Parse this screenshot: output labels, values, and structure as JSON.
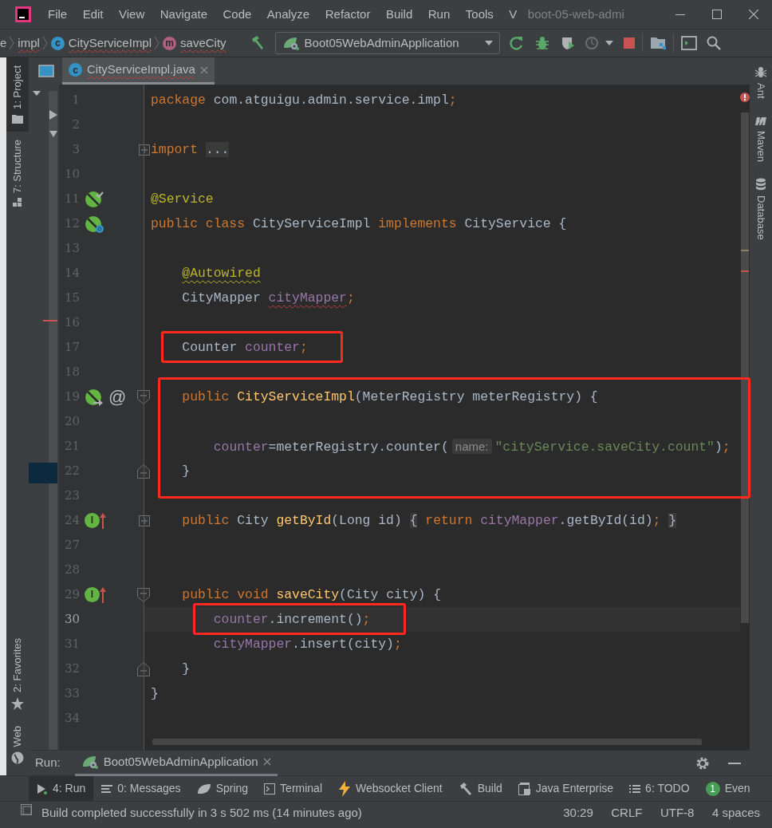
{
  "title_bar": {
    "menu": [
      "File",
      "Edit",
      "View",
      "Navigate",
      "Code",
      "Analyze",
      "Refactor",
      "Build",
      "Run",
      "Tools",
      "V"
    ],
    "title": "boot-05-web-admi"
  },
  "nav_bar": {
    "breadcrumbs": [
      {
        "text": "e",
        "kind": "plain",
        "error": false
      },
      {
        "text": "impl",
        "kind": "plain",
        "error": true
      },
      {
        "text": "CityServiceImpl",
        "kind": "class",
        "icon_letter": "c",
        "error": true
      },
      {
        "text": "saveCity",
        "kind": "method",
        "icon_letter": "m",
        "error": true
      }
    ],
    "run_config": "Boot05WebAdminApplication"
  },
  "editor_tabs": [
    {
      "label": "CityServiceImpl.java",
      "icon_letter": "c",
      "selected": true,
      "error": true
    }
  ],
  "left_tool_windows": [
    {
      "label": "1: Project",
      "kind": "project",
      "selected": true
    },
    {
      "label": "7: Structure",
      "kind": "structure",
      "selected": false
    }
  ],
  "left_bottom_tool_windows": [
    {
      "label": "2: Favorites",
      "kind": "favorites",
      "selected": false
    },
    {
      "label": "Web",
      "kind": "web",
      "selected": false
    }
  ],
  "right_tool_windows": [
    {
      "label": "Ant",
      "kind": "ant"
    },
    {
      "label": "Maven",
      "kind": "maven"
    },
    {
      "label": "Database",
      "kind": "database"
    }
  ],
  "code": {
    "sections": [
      {
        "highlighted": false,
        "lines": [
          {
            "number": "1",
            "current": false,
            "tokens": [
              {
                "kind": "kw",
                "t": "package"
              },
              {
                "kind": "plain",
                "t": " com.atguigu.admin.service.impl"
              },
              {
                "kind": "kw",
                "t": ";"
              }
            ]
          },
          {
            "number": "2",
            "current": false
          },
          {
            "number": "3",
            "current": false,
            "fold": {
              "kind": "plus"
            },
            "tokens": [
              {
                "kind": "kw",
                "t": "import"
              },
              {
                "kind": "folded",
                "t": " ..."
              }
            ]
          },
          {
            "number": "10",
            "current": false
          },
          {
            "number": "11",
            "current": false,
            "gutter": [
              {
                "kind": "bean-check"
              }
            ],
            "tokens": [
              {
                "kind": "ann",
                "t": "@Service"
              }
            ]
          },
          {
            "number": "12",
            "current": false,
            "gutter": [
              {
                "kind": "bean-class"
              }
            ],
            "tokens": [
              {
                "kind": "kw",
                "t": "public class "
              },
              {
                "kind": "plain",
                "t": "CityServiceImpl "
              },
              {
                "kind": "kw",
                "t": "implements "
              },
              {
                "kind": "plain",
                "t": "CityService {"
              }
            ]
          },
          {
            "number": "13",
            "current": false
          },
          {
            "number": "14",
            "current": false,
            "tokens": [
              {
                "kind": "ann",
                "t": "    @Autowired",
                "squiggle": {
                  "kind": "warning"
                }
              }
            ]
          },
          {
            "number": "15",
            "current": false,
            "tokens": [
              {
                "kind": "plain",
                "t": "    CityMapper "
              },
              {
                "kind": "field",
                "t": "cityMapper",
                "squiggle": {
                  "kind": "error"
                }
              },
              {
                "kind": "kw",
                "t": ";"
              }
            ]
          },
          {
            "number": "16",
            "current": false
          }
        ]
      },
      {
        "highlighted": true,
        "lines": [
          {
            "number": "17",
            "current": false,
            "tokens": [
              {
                "kind": "plain",
                "t": "    Counter "
              },
              {
                "kind": "field",
                "t": "counter"
              },
              {
                "kind": "kw",
                "t": ";"
              }
            ]
          }
        ]
      },
      {
        "highlighted": false,
        "lines": [
          {
            "number": "18",
            "current": false
          }
        ]
      },
      {
        "highlighted": true,
        "lines": [
          {
            "number": "19",
            "current": false,
            "fold": {
              "kind": "start"
            },
            "gutter": [
              {
                "kind": "bean-arrow"
              },
              {
                "kind": "text",
                "text": "@"
              }
            ],
            "tokens": [
              {
                "kind": "kw",
                "t": "    public "
              },
              {
                "kind": "method",
                "t": "CityServiceImpl"
              },
              {
                "kind": "plain",
                "t": "(MeterRegistry meterRegistry) {"
              }
            ]
          },
          {
            "number": "20",
            "current": false
          },
          {
            "number": "21",
            "current": false,
            "tokens": [
              {
                "kind": "field",
                "t": "        counter"
              },
              {
                "kind": "plain",
                "t": "=meterRegistry.counter("
              },
              {
                "kind": "hint",
                "t": "name:"
              },
              {
                "kind": "str",
                "t": "″cityService.saveCity.count″"
              },
              {
                "kind": "plain",
                "t": ")"
              },
              {
                "kind": "kw",
                "t": ";"
              }
            ]
          },
          {
            "number": "22",
            "current": false,
            "fold": {
              "kind": "end"
            },
            "tokens": [
              {
                "kind": "plain",
                "t": "    }"
              }
            ]
          }
        ]
      },
      {
        "highlighted": false,
        "lines": [
          {
            "number": "23",
            "current": false
          },
          {
            "number": "24",
            "current": false,
            "fold": {
              "kind": "plus"
            },
            "gutter": [
              {
                "kind": "implemented",
                "letter": "I"
              }
            ],
            "tokens": [
              {
                "kind": "kw",
                "t": "    public "
              },
              {
                "kind": "plain",
                "t": "City "
              },
              {
                "kind": "method",
                "t": "getById"
              },
              {
                "kind": "plain",
                "t": "(Long id) "
              },
              {
                "kind": "folded",
                "t": "{"
              },
              {
                "kind": "kw",
                "t": " return "
              },
              {
                "kind": "field",
                "t": "cityMapper"
              },
              {
                "kind": "plain",
                "t": ".getById(id)"
              },
              {
                "kind": "kw",
                "t": ";"
              },
              {
                "kind": "folded",
                "t": " }"
              }
            ]
          },
          {
            "number": "27",
            "current": false
          },
          {
            "number": "28",
            "current": false
          },
          {
            "number": "29",
            "current": false,
            "fold": {
              "kind": "start"
            },
            "gutter": [
              {
                "kind": "implemented",
                "letter": "I"
              }
            ],
            "tokens": [
              {
                "kind": "kw",
                "t": "    public void "
              },
              {
                "kind": "method",
                "t": "saveCity"
              },
              {
                "kind": "plain",
                "t": "(City city) {"
              }
            ]
          }
        ]
      },
      {
        "highlighted": true,
        "lines": [
          {
            "number": "30",
            "current": true,
            "tokens": [
              {
                "kind": "field",
                "t": "        counter"
              },
              {
                "kind": "plain",
                "t": ".increment()"
              },
              {
                "kind": "kw",
                "t": ";"
              }
            ]
          }
        ]
      },
      {
        "highlighted": false,
        "lines": [
          {
            "number": "31",
            "current": false,
            "tokens": [
              {
                "kind": "field",
                "t": "        cityMapper"
              },
              {
                "kind": "plain",
                "t": ".insert(city)"
              },
              {
                "kind": "kw",
                "t": ";"
              }
            ]
          },
          {
            "number": "32",
            "current": false,
            "fold": {
              "kind": "end"
            },
            "tokens": [
              {
                "kind": "plain",
                "t": "    }"
              }
            ]
          },
          {
            "number": "33",
            "current": false,
            "tokens": [
              {
                "kind": "plain",
                "t": "}"
              }
            ]
          },
          {
            "number": "34",
            "current": false
          }
        ]
      }
    ]
  },
  "run_panel": {
    "label": "Run:",
    "tabs": [
      {
        "label": "Boot05WebAdminApplication",
        "selected": true
      }
    ]
  },
  "tool_tabs": [
    {
      "label": "4: Run",
      "kind": "run",
      "selected": true
    },
    {
      "label": "0: Messages",
      "kind": "messages",
      "selected": false
    },
    {
      "label": "Spring",
      "kind": "spring",
      "selected": false
    },
    {
      "label": "Terminal",
      "kind": "terminal",
      "selected": false
    },
    {
      "label": "Websocket Client",
      "kind": "websocket",
      "selected": false
    },
    {
      "label": "Build",
      "kind": "build",
      "selected": false
    },
    {
      "label": "Java Enterprise",
      "kind": "javaee",
      "selected": false
    },
    {
      "label": "6: TODO",
      "kind": "todo",
      "selected": false
    },
    {
      "label": "Even",
      "kind": "event-log",
      "badge": "1",
      "selected": false
    }
  ],
  "status_bar": {
    "message": "Build completed successfully in 3 s 502 ms (14 minutes ago)",
    "position": "30:29",
    "line_separator": "CRLF",
    "encoding": "UTF-8",
    "indent": "4 spaces"
  }
}
